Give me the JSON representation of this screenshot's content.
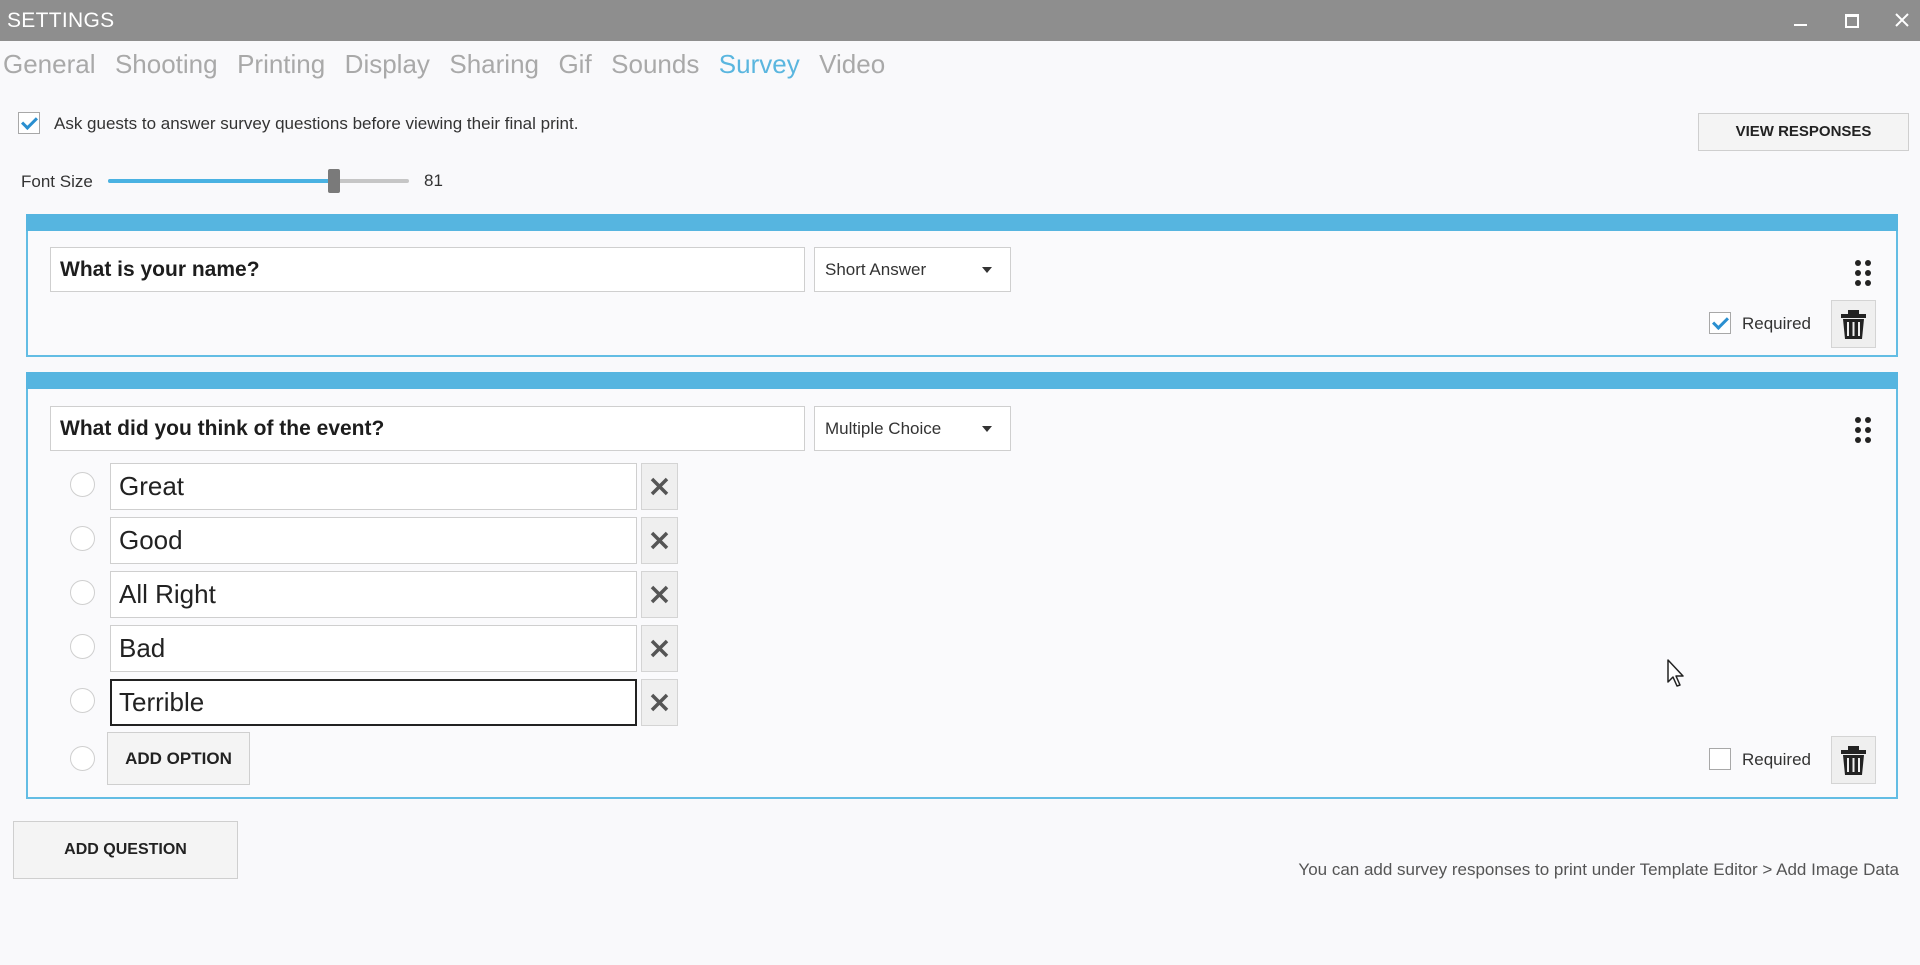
{
  "window": {
    "title": "SETTINGS"
  },
  "tabs": [
    {
      "label": "General",
      "active": false
    },
    {
      "label": "Shooting",
      "active": false
    },
    {
      "label": "Printing",
      "active": false
    },
    {
      "label": "Display",
      "active": false
    },
    {
      "label": "Sharing",
      "active": false
    },
    {
      "label": "Gif",
      "active": false
    },
    {
      "label": "Sounds",
      "active": false
    },
    {
      "label": "Survey",
      "active": true
    },
    {
      "label": "Video",
      "active": false
    }
  ],
  "survey": {
    "ask_guests_checked": true,
    "ask_guests_label": "Ask guests to answer survey questions before viewing their final print.",
    "view_responses_label": "VIEW RESPONSES",
    "font_size_label": "Font Size",
    "font_size_value": "81",
    "font_size_fraction": 0.75
  },
  "questions": [
    {
      "text": "What is your name?",
      "type": "Short Answer",
      "required_label": "Required",
      "required": true,
      "options": []
    },
    {
      "text": "What did you think of the event?",
      "type": "Multiple Choice",
      "required_label": "Required",
      "required": false,
      "add_option_label": "ADD OPTION",
      "options": [
        "Great",
        "Good",
        "All Right",
        "Bad",
        "Terrible"
      ]
    }
  ],
  "footer": {
    "add_question_label": "ADD QUESTION",
    "note": "You can add survey responses to print under Template Editor > Add Image Data"
  },
  "colors": {
    "accent": "#56b5e0",
    "active_tab": "#5ab6df",
    "title_bar": "#8e8e8e"
  }
}
